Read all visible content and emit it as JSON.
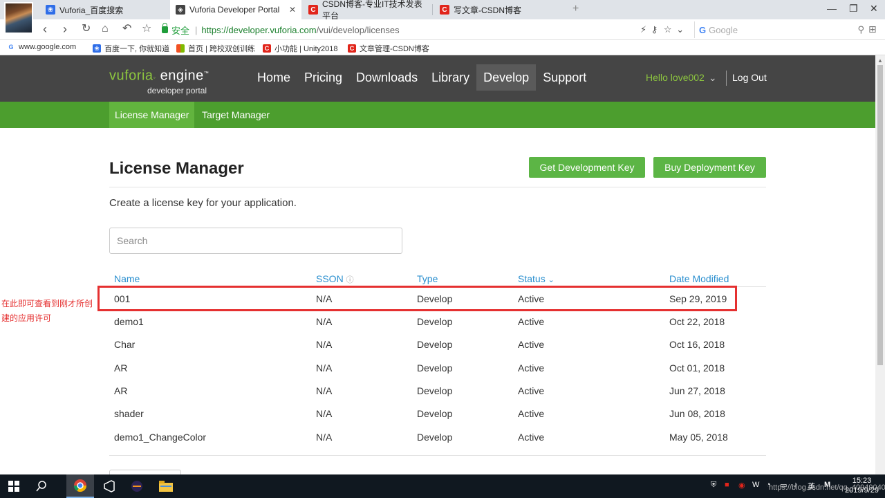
{
  "browser": {
    "tabs": [
      {
        "label": "Vuforia_百度搜索",
        "icon": "baidu-paw-icon"
      },
      {
        "label": "Vuforia Developer Portal",
        "icon": "vuforia-icon",
        "active": true
      },
      {
        "label": "CSDN博客-专业IT技术发表平台",
        "icon": "csdn-icon"
      },
      {
        "label": "写文章-CSDN博客",
        "icon": "csdn-icon"
      }
    ],
    "address": {
      "secure_label": "安全",
      "host": "https://developer.vuforia.com",
      "path": "/vui/develop/licenses",
      "search_engine": "Google",
      "search_placeholder": "Google"
    },
    "bookmarks": [
      {
        "label": "www.google.com",
        "icon": "google-g-icon"
      },
      {
        "label": "百度一下, 你就知道",
        "icon": "baidu-paw-icon"
      },
      {
        "label": "首页 | 跨校双创训练",
        "icon": "windows-flag-icon"
      },
      {
        "label": "小功能 | Unity2018",
        "icon": "csdn-icon"
      },
      {
        "label": "文章管理-CSDN博客",
        "icon": "csdn-icon"
      }
    ]
  },
  "site": {
    "logo_main": "vuforia",
    "logo_engine": "engine",
    "logo_sub": "developer portal",
    "nav": [
      "Home",
      "Pricing",
      "Downloads",
      "Library",
      "Develop",
      "Support"
    ],
    "nav_selected": "Develop",
    "greeting": "Hello love002",
    "logout": "Log Out",
    "subnav": [
      "License Manager",
      "Target Manager"
    ],
    "subnav_selected": "License Manager"
  },
  "license_manager": {
    "title": "License Manager",
    "get_dev_key": "Get Development Key",
    "buy_deploy_key": "Buy Deployment Key",
    "intro": "Create a license key for your application.",
    "search_placeholder": "Search",
    "columns": [
      "Name",
      "SSON",
      "Type",
      "Status",
      "Date Modified"
    ],
    "sorted_column": "Status",
    "rows": [
      {
        "name": "001",
        "sson": "N/A",
        "type": "Develop",
        "status": "Active",
        "date": "Sep 29, 2019"
      },
      {
        "name": "demo1",
        "sson": "N/A",
        "type": "Develop",
        "status": "Active",
        "date": "Oct 22, 2018"
      },
      {
        "name": "Char",
        "sson": "N/A",
        "type": "Develop",
        "status": "Active",
        "date": "Oct 16, 2018"
      },
      {
        "name": "AR",
        "sson": "N/A",
        "type": "Develop",
        "status": "Active",
        "date": "Oct 01, 2018"
      },
      {
        "name": "AR",
        "sson": "N/A",
        "type": "Develop",
        "status": "Active",
        "date": "Jun 27, 2018"
      },
      {
        "name": "shader",
        "sson": "N/A",
        "type": "Develop",
        "status": "Active",
        "date": "Jun 08, 2018"
      },
      {
        "name": "demo1_ChangeColor",
        "sson": "N/A",
        "type": "Develop",
        "status": "Active",
        "date": "May 05, 2018"
      }
    ]
  },
  "annotation": {
    "line1": "在此即可查看到刚才所创",
    "line2": "建的应用许可",
    "color": "#e53030"
  },
  "taskbar": {
    "time": "15:23",
    "date": "2019/9/29",
    "ime": "英",
    "watermark": "https://blog.csdn.net/qq_40949040"
  },
  "colors": {
    "header_bg": "#454545",
    "subnav_bg": "#4c9e2e",
    "accent_green": "#5cb545",
    "link_blue": "#2a8fcf"
  }
}
